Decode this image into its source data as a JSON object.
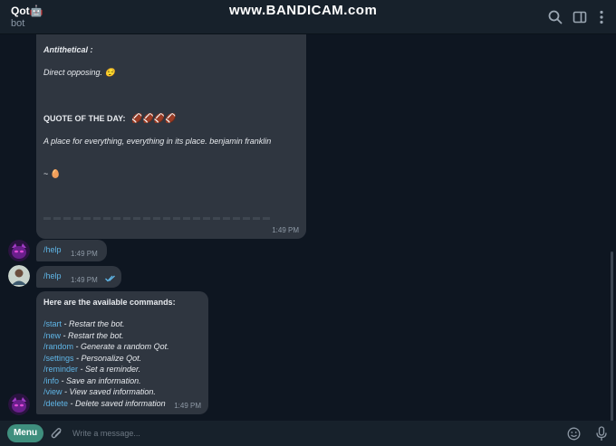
{
  "header": {
    "title": "Qot🤖",
    "subtitle": "bot",
    "watermark": "www.BANDICAM.com",
    "icons": [
      "search-icon",
      "sidebar-toggle-icon",
      "more-vertical-icon"
    ]
  },
  "messages": {
    "quote_bubble": {
      "antithetical_label": "Antithetical :",
      "antithetical_meaning": "Direct opposing. 😌",
      "quote_title": "QUOTE OF THE DAY:",
      "quote_emojis": "🏈🏈🏈🏈",
      "quote_text": "A place for everything, everything in its place. benjamin franklin",
      "sign": "~ 🥚",
      "time": "1:49 PM"
    },
    "bot_help": {
      "text": "/help",
      "time": "1:49 PM"
    },
    "user_help": {
      "text": "/help",
      "time": "1:49 PM"
    },
    "commands_bubble": {
      "title": "Here are the available commands:",
      "commands": [
        {
          "cmd": "/start",
          "desc": "- Restart the bot."
        },
        {
          "cmd": "/new",
          "desc": "- Restart the bot."
        },
        {
          "cmd": "/random",
          "desc": "- Generate a random Qot."
        },
        {
          "cmd": "/settings",
          "desc": "- Personalize Qot."
        },
        {
          "cmd": "/reminder",
          "desc": "- Set a reminder."
        },
        {
          "cmd": "/info",
          "desc": "- Save an information."
        },
        {
          "cmd": "/view",
          "desc": "- View saved information."
        },
        {
          "cmd": "/delete",
          "desc": "- Delete saved information"
        }
      ],
      "time": "1:49 PM"
    }
  },
  "footer": {
    "menu_label": "Menu",
    "placeholder": "Write a message...",
    "icons": [
      "attach-icon",
      "emoji-icon",
      "microphone-icon"
    ]
  },
  "colors": {
    "background": "#0e1621",
    "bubble": "#2f3640",
    "accent": "#5fb5e6",
    "menu": "#3f8f7e"
  }
}
